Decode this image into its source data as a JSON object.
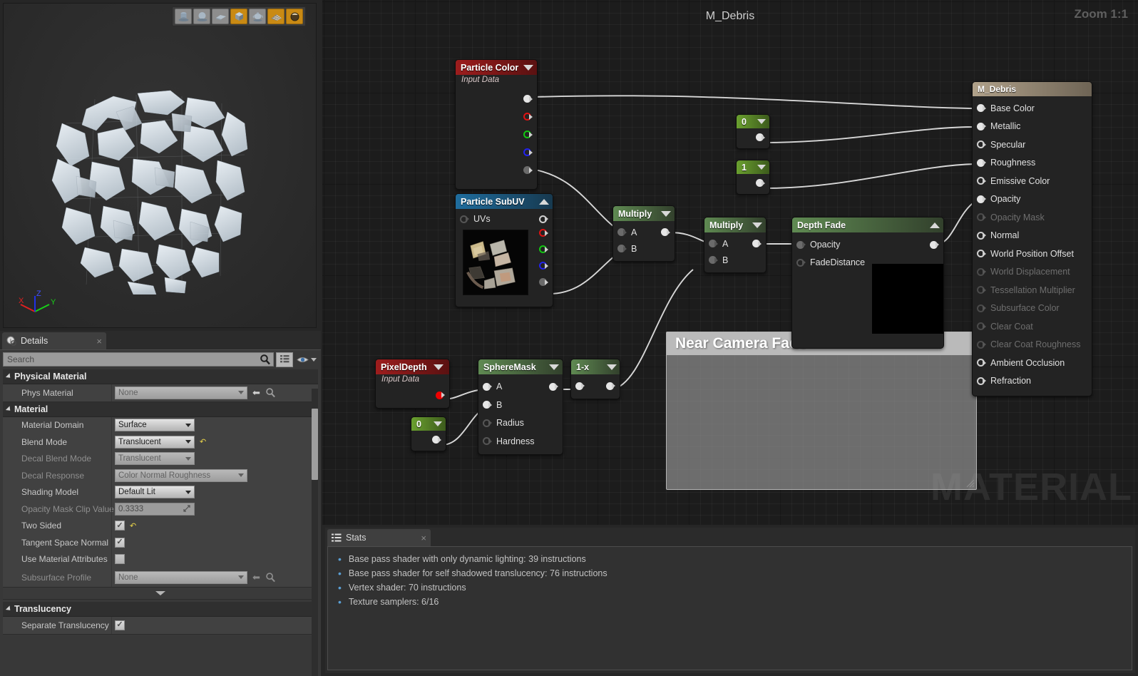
{
  "viewport": {
    "shape_buttons": [
      {
        "name": "cylinder-preview-button",
        "icon": "cylinder-icon",
        "active": false
      },
      {
        "name": "sphere-preview-button",
        "icon": "sphere-icon",
        "active": false
      },
      {
        "name": "plane-preview-button",
        "icon": "plane-icon",
        "active": false
      },
      {
        "name": "cube-preview-button",
        "icon": "cube-icon",
        "active": true
      },
      {
        "name": "teapot-preview-button",
        "icon": "teapot-icon",
        "active": false
      },
      {
        "name": "grid-preview-button",
        "icon": "grid-icon",
        "active": true
      },
      {
        "name": "custom-mesh-preview-button",
        "icon": "sphere-material-icon",
        "active": true
      }
    ],
    "axis_labels": {
      "x": "X",
      "y": "Y",
      "z": "Z"
    }
  },
  "details": {
    "tab_label": "Details",
    "tab_close": "×",
    "search": {
      "placeholder": "Search",
      "value": ""
    },
    "toolbar": {
      "grid_view_icon": "grid-view-icon",
      "visibility_icon": "eye-icon"
    },
    "categories": [
      {
        "name": "Physical Material",
        "rows": [
          {
            "label": "Phys Material",
            "type": "asset",
            "value": "None",
            "dim": true
          }
        ]
      },
      {
        "name": "Material",
        "rows": [
          {
            "label": "Material Domain",
            "type": "combo",
            "value": "Surface",
            "dim": false
          },
          {
            "label": "Blend Mode",
            "type": "combo",
            "value": "Translucent",
            "dim": false,
            "revert": true
          },
          {
            "label": "Decal Blend Mode",
            "type": "combo",
            "value": "Translucent",
            "dim": true
          },
          {
            "label": "Decal Response",
            "type": "combo-wide",
            "value": "Color Normal Roughness",
            "dim": true
          },
          {
            "label": "Shading Model",
            "type": "combo",
            "value": "Default Lit",
            "dim": false
          },
          {
            "label": "Opacity Mask Clip Value",
            "type": "number",
            "value": "0.3333",
            "dim": true
          },
          {
            "label": "Two Sided",
            "type": "checkbox",
            "value": true,
            "revert": true
          },
          {
            "label": "Tangent Space Normal",
            "type": "checkbox",
            "value": true
          },
          {
            "label": "Use Material Attributes",
            "type": "checkbox",
            "value": false
          },
          {
            "label": "Subsurface Profile",
            "type": "asset",
            "value": "None",
            "dim": true
          }
        ]
      },
      {
        "name": "Translucency",
        "rows": [
          {
            "label": "Separate Translucency",
            "type": "checkbox",
            "value": true
          }
        ]
      }
    ]
  },
  "graph": {
    "title": "M_Debris",
    "zoom_label": "Zoom 1:1",
    "watermark": "MATERIAL",
    "comment": {
      "title": "Near Camera Fade"
    },
    "nodes": [
      {
        "id": "particle-color",
        "title": "Particle Color",
        "subtitle": "Input Data",
        "header_style": "red",
        "collapse": "down",
        "outputs": [
          {
            "label": "",
            "pin": "filled"
          },
          {
            "label": "",
            "pin": "red"
          },
          {
            "label": "",
            "pin": "green"
          },
          {
            "label": "",
            "pin": "blue"
          },
          {
            "label": "",
            "pin": "grey"
          }
        ]
      },
      {
        "id": "particle-subuv",
        "title": "Particle SubUV",
        "header_style": "blue",
        "collapse": "up",
        "inputs": [
          {
            "label": "UVs",
            "pin": "greyhollow"
          }
        ],
        "outputs": [
          {
            "label": "",
            "pin": "hollow"
          },
          {
            "label": "",
            "pin": "red"
          },
          {
            "label": "",
            "pin": "green"
          },
          {
            "label": "",
            "pin": "blue"
          },
          {
            "label": "",
            "pin": "grey"
          }
        ],
        "has_thumbnail": true
      },
      {
        "id": "multiply-1",
        "title": "Multiply",
        "header_style": "green",
        "collapse": "down",
        "inputs": [
          {
            "label": "A",
            "pin": "grey"
          },
          {
            "label": "B",
            "pin": "grey"
          }
        ],
        "outputs": [
          {
            "label": "",
            "pin": "filled"
          }
        ]
      },
      {
        "id": "multiply-2",
        "title": "Multiply",
        "header_style": "green",
        "collapse": "down",
        "inputs": [
          {
            "label": "A",
            "pin": "grey"
          },
          {
            "label": "B",
            "pin": "grey"
          }
        ],
        "outputs": [
          {
            "label": "",
            "pin": "filled"
          }
        ]
      },
      {
        "id": "constant-0-top",
        "title": "0",
        "header_style": "greenbright",
        "collapse": "down",
        "outputs": [
          {
            "label": "",
            "pin": "filled"
          }
        ]
      },
      {
        "id": "constant-1",
        "title": "1",
        "header_style": "greenbright",
        "collapse": "down",
        "outputs": [
          {
            "label": "",
            "pin": "filled"
          }
        ]
      },
      {
        "id": "depth-fade",
        "title": "Depth Fade",
        "header_style": "green",
        "collapse": "up",
        "inputs": [
          {
            "label": "Opacity",
            "pin": "grey"
          },
          {
            "label": "FadeDistance",
            "pin": "greyhollow"
          }
        ],
        "outputs": [
          {
            "label": "",
            "pin": "filled"
          }
        ],
        "has_thumbnail": true
      },
      {
        "id": "pixel-depth",
        "title": "PixelDepth",
        "subtitle": "Input Data",
        "header_style": "red",
        "collapse": "down",
        "outputs": [
          {
            "label": "",
            "pin": "redfill"
          }
        ]
      },
      {
        "id": "constant-0-bottom",
        "title": "0",
        "header_style": "greenbright",
        "collapse": "down",
        "outputs": [
          {
            "label": "",
            "pin": "filled"
          }
        ]
      },
      {
        "id": "sphere-mask",
        "title": "SphereMask",
        "header_style": "green",
        "collapse": "down",
        "inputs": [
          {
            "label": "A",
            "pin": "filled"
          },
          {
            "label": "B",
            "pin": "filled"
          },
          {
            "label": "Radius",
            "pin": "greyhollow"
          },
          {
            "label": "Hardness",
            "pin": "greyhollow"
          }
        ],
        "outputs": [
          {
            "label": "",
            "pin": "filled"
          }
        ]
      },
      {
        "id": "one-minus-x",
        "title": "1-x",
        "header_style": "green",
        "collapse": "down",
        "inputs": [
          {
            "label": "",
            "pin": "filled"
          }
        ],
        "outputs": [
          {
            "label": "",
            "pin": "filled"
          }
        ]
      }
    ],
    "output_node": {
      "title": "M_Debris",
      "inputs": [
        {
          "label": "Base Color",
          "pin": "filled",
          "dim": false
        },
        {
          "label": "Metallic",
          "pin": "filled",
          "dim": false
        },
        {
          "label": "Specular",
          "pin": "hollow",
          "dim": false
        },
        {
          "label": "Roughness",
          "pin": "filled",
          "dim": false
        },
        {
          "label": "Emissive Color",
          "pin": "hollow",
          "dim": false
        },
        {
          "label": "Opacity",
          "pin": "filled",
          "dim": false
        },
        {
          "label": "Opacity Mask",
          "pin": "dimhollow",
          "dim": true
        },
        {
          "label": "Normal",
          "pin": "hollow",
          "dim": false
        },
        {
          "label": "World Position Offset",
          "pin": "hollow",
          "dim": false
        },
        {
          "label": "World Displacement",
          "pin": "dimhollow",
          "dim": true
        },
        {
          "label": "Tessellation Multiplier",
          "pin": "dimhollow",
          "dim": true
        },
        {
          "label": "Subsurface Color",
          "pin": "dimhollow",
          "dim": true
        },
        {
          "label": "Clear Coat",
          "pin": "dimhollow",
          "dim": true
        },
        {
          "label": "Clear Coat Roughness",
          "pin": "dimhollow",
          "dim": true
        },
        {
          "label": "Ambient Occlusion",
          "pin": "hollow",
          "dim": false
        },
        {
          "label": "Refraction",
          "pin": "hollow",
          "dim": false
        }
      ]
    }
  },
  "stats": {
    "tab_label": "Stats",
    "tab_close": "×",
    "lines": [
      "Base pass shader with only dynamic lighting: 39 instructions",
      "Base pass shader for self shadowed translucency: 76 instructions",
      "Vertex shader: 70 instructions",
      "Texture samplers: 6/16"
    ]
  },
  "colors": {
    "accent_orange": "#c98a14",
    "node_green": "#5f8a52",
    "node_red": "#9d1d1d",
    "node_blue": "#1f6d9e",
    "bullet_blue": "#5a9fd4"
  }
}
